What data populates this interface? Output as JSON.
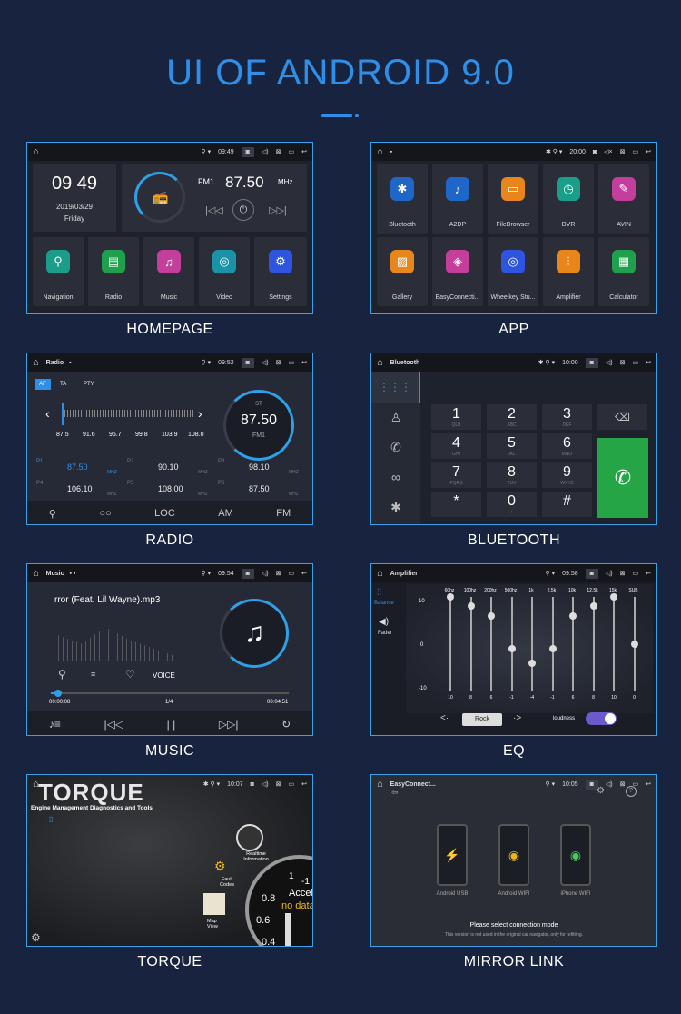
{
  "page": {
    "title": "UI OF ANDROID 9.0"
  },
  "captions": {
    "home": "HOMEPAGE",
    "app": "APP",
    "radio": "RADIO",
    "bluetooth": "BLUETOOTH",
    "music": "MUSIC",
    "eq": "EQ",
    "torque": "TORQUE",
    "mirror": "MIRROR LINK"
  },
  "home": {
    "time_status": "09:49",
    "clock": "09 49",
    "date": "2019/03/29",
    "day": "Friday",
    "band": "FM1",
    "freq": "87.50",
    "unit": "MHz",
    "apps": [
      "Navigation",
      "Radio",
      "Music",
      "Video",
      "Settings"
    ],
    "colors": [
      "#1a9e8a",
      "#1fa04c",
      "#c43f9c",
      "#1a93a8",
      "#2e55e0"
    ]
  },
  "apps": {
    "time_status": "20:00",
    "items": [
      "Bluetooth",
      "A2DP",
      "FileBrowser",
      "DVR",
      "AVIN",
      "Gallery",
      "EasyConnecti...",
      "Wheelkey Stu...",
      "Amplifier",
      "Calculator"
    ],
    "colors": [
      "#1e66c8",
      "#1e66c8",
      "#e8861c",
      "#1a9e8a",
      "#c43f9c",
      "#e8861c",
      "#c43f9c",
      "#2e55e0",
      "#e8861c",
      "#1fa04c"
    ]
  },
  "radio": {
    "title": "Radio",
    "time_status": "09:52",
    "tags": [
      "AF",
      "TA",
      "PTY"
    ],
    "scale": [
      "87.5",
      "91.6",
      "95.7",
      "99.8",
      "103.9",
      "108.0"
    ],
    "st": "ST",
    "freq": "87.50",
    "band": "FM1",
    "presets": [
      {
        "p": "P1",
        "f": "87.50"
      },
      {
        "p": "P2",
        "f": "90.10"
      },
      {
        "p": "P3",
        "f": "98.10"
      },
      {
        "p": "P4",
        "f": "106.10"
      },
      {
        "p": "P5",
        "f": "108.00"
      },
      {
        "p": "P6",
        "f": "87.50"
      }
    ],
    "mhz": "MHZ",
    "bottom": [
      "LOC",
      "AM",
      "FM"
    ]
  },
  "bt": {
    "title": "Bluetooth",
    "time_status": "10:00",
    "keys": [
      {
        "n": "1",
        "s": "QLB"
      },
      {
        "n": "2",
        "s": "ABC"
      },
      {
        "n": "3",
        "s": "DEF"
      },
      {
        "n": "4",
        "s": "GHI"
      },
      {
        "n": "5",
        "s": "JKL"
      },
      {
        "n": "6",
        "s": "MNO"
      },
      {
        "n": "7",
        "s": "PQRS"
      },
      {
        "n": "8",
        "s": "TUV"
      },
      {
        "n": "9",
        "s": "WXYZ"
      },
      {
        "n": "*",
        "s": ""
      },
      {
        "n": "0",
        "s": "+"
      },
      {
        "n": "#",
        "s": ""
      }
    ]
  },
  "music": {
    "title": "Music",
    "time_status": "09:54",
    "song": "rror (Feat. Lil Wayne).mp3",
    "voice": "VOICE",
    "elapsed": "00:00:08",
    "track": "1/4",
    "total": "00:04:51",
    "progress": 0.03
  },
  "eq": {
    "title": "Amplifier",
    "time_status": "09:58",
    "bands": [
      "60hz",
      "100hz",
      "200hz",
      "500hz",
      "1k",
      "2.5k",
      "10k",
      "12.5k",
      "15k",
      "SUB"
    ],
    "values": [
      10,
      8,
      6,
      -1,
      -4,
      -1,
      6,
      8,
      10,
      0
    ],
    "scale": [
      "10",
      "0",
      "-10"
    ],
    "side": [
      "Balance",
      "Fader"
    ],
    "preset": "Rock",
    "loudness": "loudness"
  },
  "torque": {
    "time_status": "10:07",
    "brand": "TORQUE",
    "sub": "Engine Management Diagnostics and Tools",
    "items": [
      "Realtime Information",
      "Fault Codes",
      "Map View"
    ],
    "gauge": [
      "0.8",
      "0.6",
      "0.4"
    ],
    "accel": "Accel",
    "nodata": "no data",
    "topnums": [
      "1",
      "-1"
    ]
  },
  "mirror": {
    "title": "EasyConnect...",
    "time_status": "10:05",
    "phones": [
      "Android USB",
      "Android WIFI",
      "iPhone WIFI"
    ],
    "select": "Please select connection mode",
    "note": "This version is not used in the original car navigator, only for refitting."
  }
}
